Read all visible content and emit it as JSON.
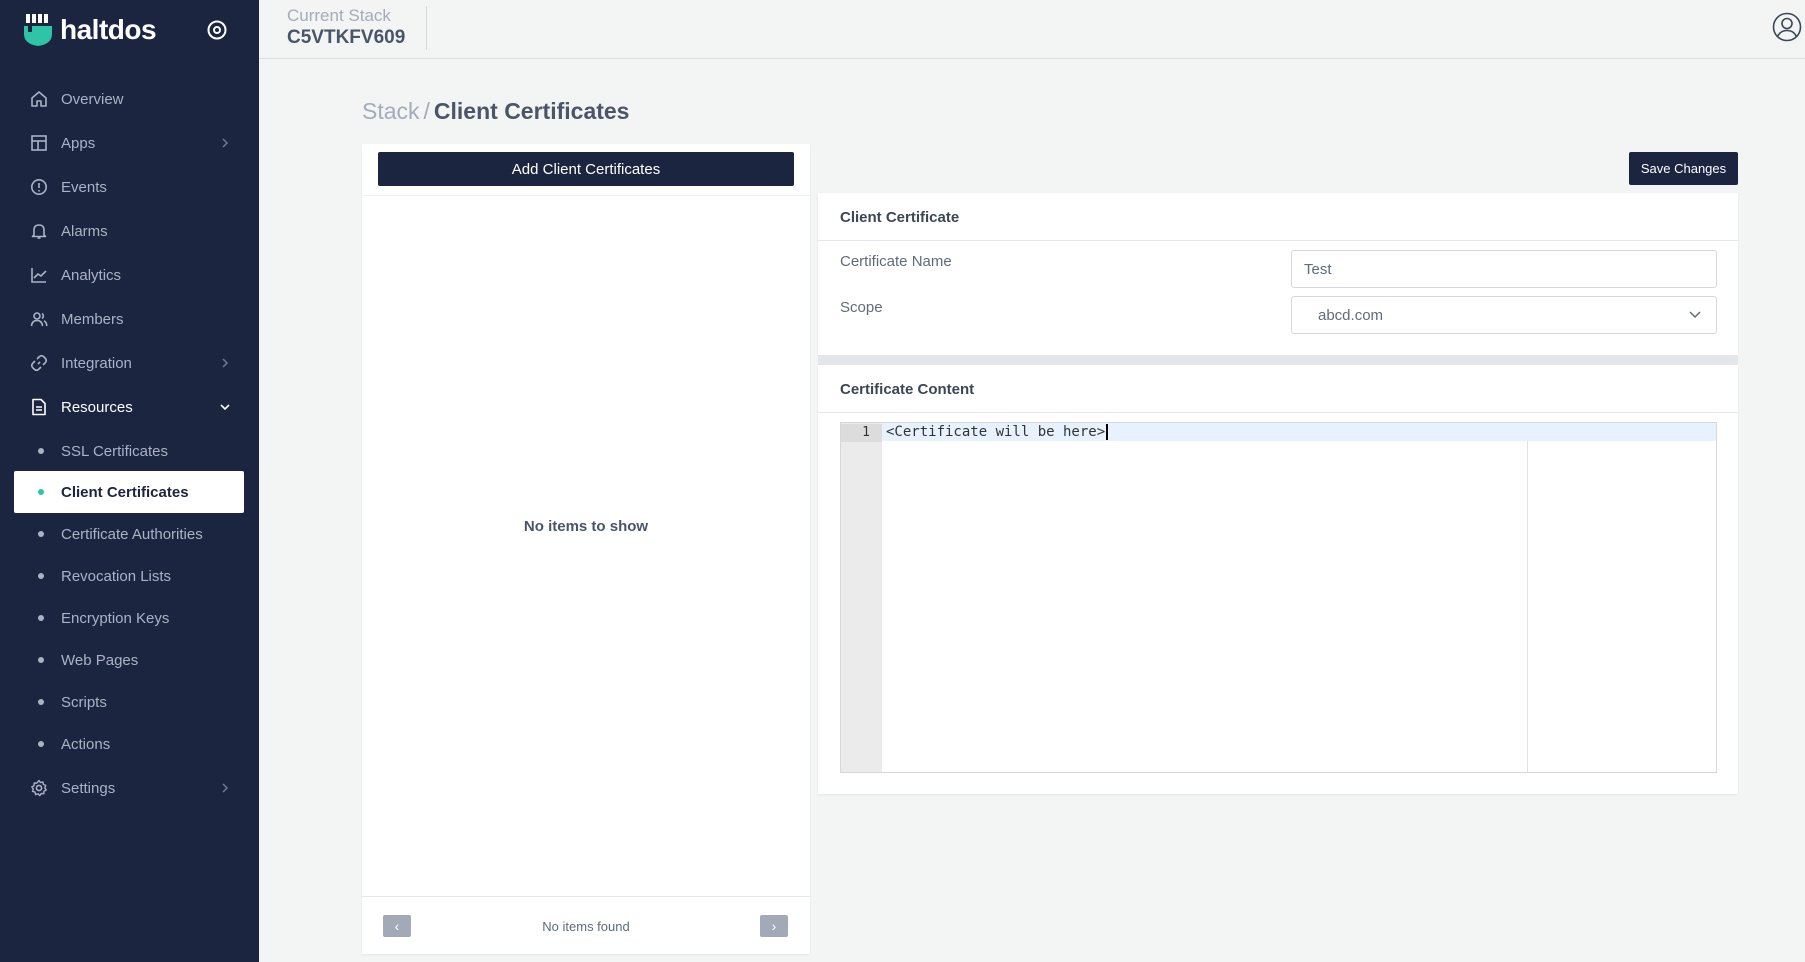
{
  "brand": {
    "name": "haltdos",
    "accent": "#2ec4a6",
    "sidebar_bg": "#1b2540"
  },
  "sidebar": {
    "items": [
      {
        "label": "Overview",
        "icon": "home-icon"
      },
      {
        "label": "Apps",
        "icon": "apps-icon"
      },
      {
        "label": "Events",
        "icon": "alert-circle-icon"
      },
      {
        "label": "Alarms",
        "icon": "bell-icon"
      },
      {
        "label": "Analytics",
        "icon": "chart-icon"
      },
      {
        "label": "Members",
        "icon": "users-icon"
      },
      {
        "label": "Integration",
        "icon": "link-icon"
      },
      {
        "label": "Resources",
        "icon": "document-icon"
      },
      {
        "label": "Settings",
        "icon": "gear-icon"
      }
    ],
    "resources_children": [
      {
        "label": "SSL Certificates"
      },
      {
        "label": "Client Certificates"
      },
      {
        "label": "Certificate Authorities"
      },
      {
        "label": "Revocation Lists"
      },
      {
        "label": "Encryption Keys"
      },
      {
        "label": "Web Pages"
      },
      {
        "label": "Scripts"
      },
      {
        "label": "Actions"
      }
    ]
  },
  "header": {
    "stack_label": "Current Stack",
    "stack_value": "C5VTKFV609"
  },
  "breadcrumb": {
    "parent": "Stack",
    "separator": "/",
    "current": "Client Certificates"
  },
  "list_panel": {
    "add_button": "Add Client Certificates",
    "empty_message": "No items to show",
    "pagination": {
      "prev": "‹",
      "info": "No items found",
      "next": "›"
    }
  },
  "toolbar": {
    "save_label": "Save Changes"
  },
  "client_certificate": {
    "title": "Client Certificate",
    "name_label": "Certificate Name",
    "name_value": "Test",
    "scope_label": "Scope",
    "scope_value": "abcd.com"
  },
  "certificate_content": {
    "title": "Certificate Content",
    "line_number": "1",
    "code": "<Certificate will be here>"
  }
}
